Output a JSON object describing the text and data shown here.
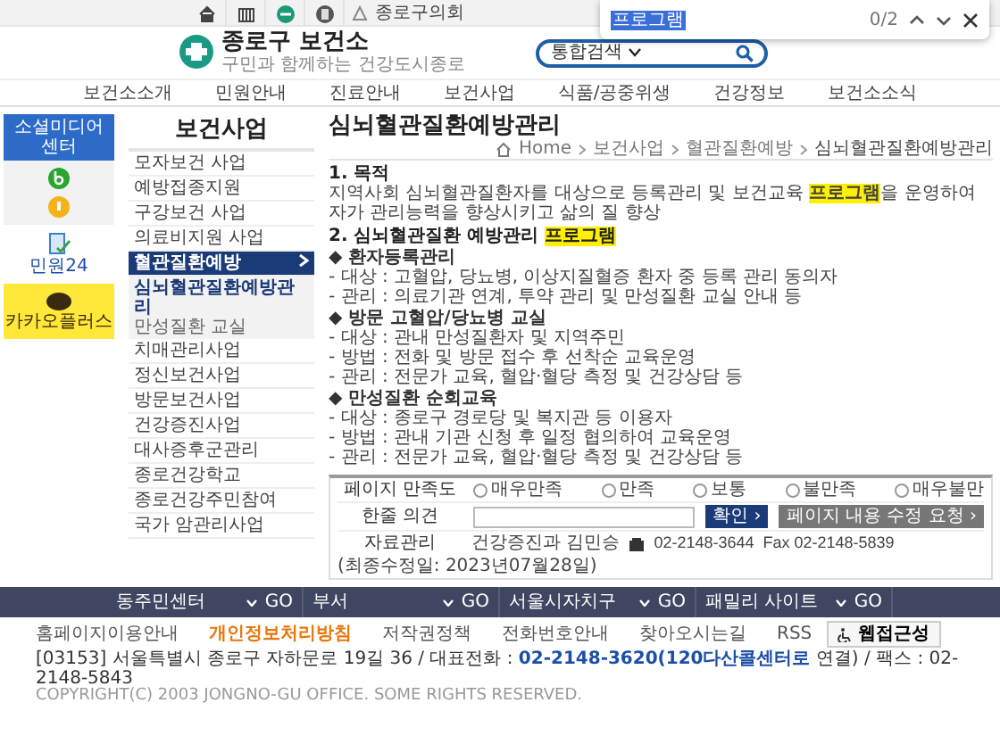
{
  "top_bar": {
    "council_link": "종로구의회"
  },
  "find_bar": {
    "query": "프로그램",
    "count": "0/2"
  },
  "header": {
    "logo_title": "종로구 보건소",
    "logo_subtitle": "구민과 함께하는 건강도시종로",
    "search": {
      "scope": "통합검색"
    }
  },
  "nav": [
    "보건소소개",
    "민원안내",
    "진료안내",
    "보건사업",
    "식품/공중위생",
    "건강정보",
    "보건소소식"
  ],
  "quick_menu": {
    "title": "소셜미디어 센터",
    "items": [
      "민원24",
      "카카오플러스"
    ]
  },
  "sidebar": {
    "title": "보건사업",
    "items": [
      {
        "label": "모자보건 사업",
        "selected": false
      },
      {
        "label": "예방접종지원",
        "selected": false
      },
      {
        "label": "구강보건 사업",
        "selected": false
      },
      {
        "label": "의료비지원 사업",
        "selected": false
      },
      {
        "label": "혈관질환예방",
        "selected": true,
        "children": [
          {
            "label": "심뇌혈관질환예방관리",
            "selected": true
          },
          {
            "label": "만성질환 교실",
            "selected": false
          }
        ]
      },
      {
        "label": "치매관리사업",
        "selected": false
      },
      {
        "label": "정신보건사업",
        "selected": false
      },
      {
        "label": "방문보건사업",
        "selected": false
      },
      {
        "label": "건강증진사업",
        "selected": false
      },
      {
        "label": "대사증후군관리",
        "selected": false
      },
      {
        "label": "종로건강학교",
        "selected": false
      },
      {
        "label": "종로건강주민참여",
        "selected": false
      },
      {
        "label": "국가 암관리사업",
        "selected": false
      }
    ]
  },
  "content": {
    "title": "심뇌혈관질환예방관리",
    "breadcrumb": [
      "Home",
      "보건사업",
      "혈관질환예방",
      "심뇌혈관질환예방관리"
    ],
    "sections": [
      {
        "heading": "1. 목적",
        "text": "지역사회 심뇌혈관질환자를 대상으로 등록관리 및 보건교육 **프로그램**을 운영하여 자가 관리능력을 향상시키고 삶의 질 향상"
      },
      {
        "heading": "2. 심뇌혈관질환 예방관리 **프로그램**",
        "groups": [
          {
            "title": "◆ 환자등록관리",
            "lines": [
              "- 대상 : 고혈압, 당뇨병, 이상지질혈증 환자 중 등록 관리 동의자",
              "- 관리 : 의료기관 연계, 투약 관리 및 만성질환 교실 안내 등"
            ]
          },
          {
            "title": "◆ 방문 고혈압/당뇨병 교실",
            "lines": [
              "- 대상 : 관내 만성질환자 및 지역주민",
              "- 방법 : 전화 및 방문 접수 후 선착순 교육운영",
              "- 관리 : 전문가 교육, 혈압·혈당 측정 및 건강상담 등"
            ]
          },
          {
            "title": "◆ 만성질환 순회교육",
            "lines": [
              "- 대상 : 종로구 경로당 및 복지관 등 이용자",
              "- 방법 : 관내 기관 신청 후 일정 협의하여 교육운영",
              "- 관리 : 전문가 교육, 혈압·혈당 측정 및 건강상담 등"
            ]
          }
        ]
      }
    ]
  },
  "rating": {
    "label": "페이지 만족도",
    "options": [
      {
        "label": "매우만족",
        "selected": false
      },
      {
        "label": "만족",
        "selected": false
      },
      {
        "label": "보통",
        "selected": false
      },
      {
        "label": "불만족",
        "selected": false
      },
      {
        "label": "매우불만",
        "selected": false
      }
    ]
  },
  "comment": {
    "label": "한줄 의견",
    "submit": "확인 ›",
    "request": "페이지 내용 수정 요청 ›"
  },
  "manager": {
    "label": "자료관리",
    "dept": "건강증진과 김민승",
    "phone": "02-2148-3644",
    "fax": "Fax 02-2148-5839",
    "updated": "(최종수정일: 2023년07월28일)"
  },
  "footer": {
    "selects": [
      {
        "label": "동주민센터",
        "go": "GO"
      },
      {
        "label": "부서",
        "go": "GO"
      },
      {
        "label": "서울시자치구",
        "go": "GO"
      },
      {
        "label": "패밀리 사이트",
        "go": "GO"
      }
    ],
    "links": [
      {
        "label": "홈페이지이용안내",
        "highlight": false
      },
      {
        "label": "개인정보처리방침",
        "highlight": true
      },
      {
        "label": "저작권정책",
        "highlight": false
      },
      {
        "label": "전화번호안내",
        "highlight": false
      },
      {
        "label": "찾아오시는길",
        "highlight": false
      },
      {
        "label": "RSS",
        "highlight": false
      }
    ],
    "access_button": "웹접근성",
    "address": {
      "before": "[03153] 서울특별시 종로구 자하문로 19길 36 / 대표전화 :",
      "phone": "02-2148-3620(120다산콜센터로",
      "after": "연결) / 팩스 : 02-2148-5843"
    },
    "copyright": "COPYRIGHT(C) 2003 JONGNO-GU OFFICE. SOME RIGHTS RESERVED."
  }
}
